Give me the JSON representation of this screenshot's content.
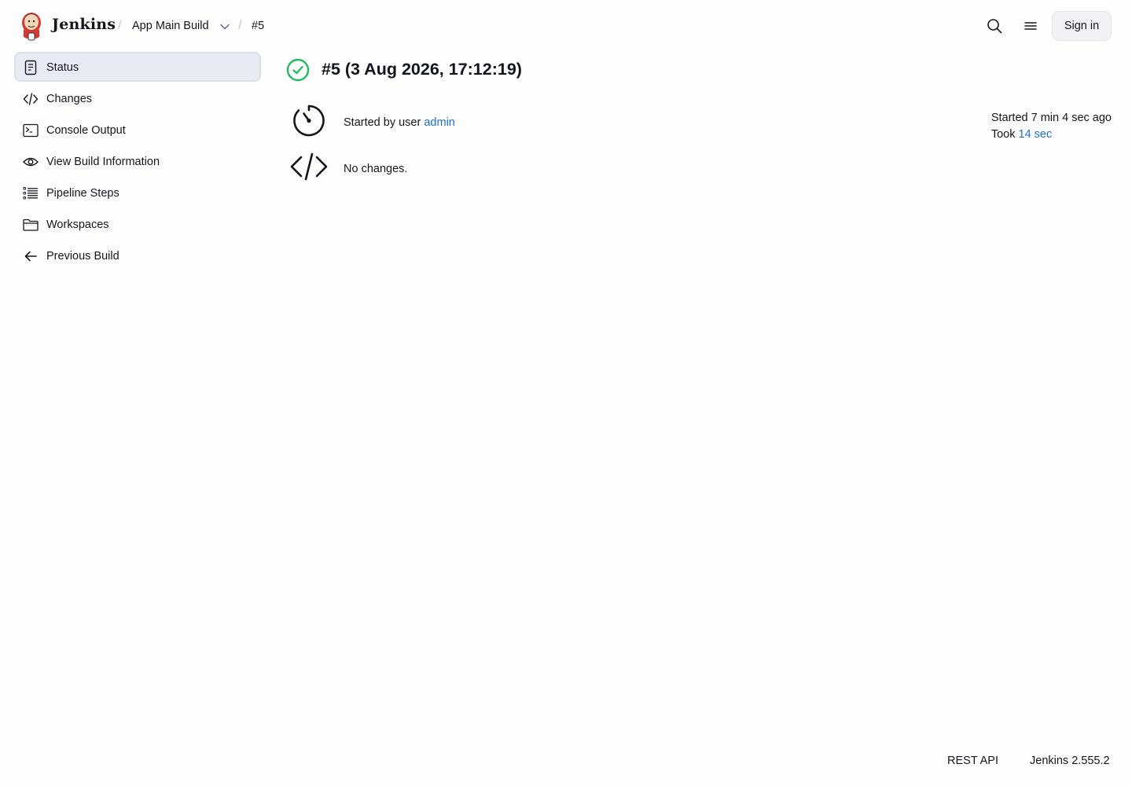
{
  "header": {
    "brand": "Jenkins",
    "breadcrumb": {
      "job": "App Main Build",
      "build": "#5"
    },
    "sign_in": "Sign in",
    "icons": [
      "search-icon",
      "menu-icon"
    ]
  },
  "sidebar": {
    "items": [
      {
        "label": "Status",
        "icon": "notepad-icon",
        "active": true
      },
      {
        "label": "Changes",
        "icon": "code-icon"
      },
      {
        "label": "Console Output",
        "icon": "terminal-icon"
      },
      {
        "label": "View Build Information",
        "icon": "eye-icon"
      },
      {
        "label": "Pipeline Steps",
        "icon": "list-icon"
      },
      {
        "label": "Workspaces",
        "icon": "folder-icon"
      },
      {
        "label": "Previous Build",
        "icon": "arrow-left-icon"
      }
    ]
  },
  "main": {
    "title": "#5 (3 Aug 2026, 17:12:19)",
    "status": "success",
    "started_by_prefix": "Started by user ",
    "started_by_user": "admin",
    "no_changes": "No changes.",
    "started_ago": "Started 7 min 4 sec ago",
    "took_prefix": "Took ",
    "took_value": "14 sec"
  },
  "footer": {
    "rest_api": "REST API",
    "version": "Jenkins 2.555.2"
  },
  "colors": {
    "success": "#1ebc5f",
    "link": "#1f6fd0",
    "active_bg": "#e9eaf2"
  }
}
